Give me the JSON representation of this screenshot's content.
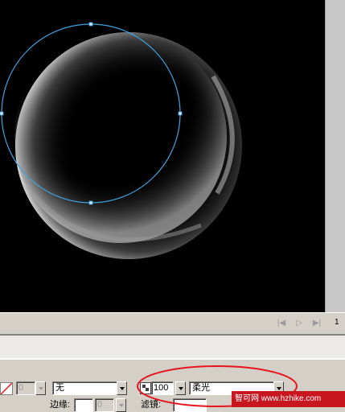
{
  "timeline": {
    "frame_number": "1"
  },
  "properties": {
    "disabled_value": "0",
    "ease_value": "无",
    "alpha_value": "100",
    "blend_mode": "柔光",
    "label_edge": "边缘:",
    "label_filter": "滤镜:",
    "edge_value": "0"
  },
  "watermark": {
    "text": "智可网 www.hzhike.com"
  },
  "colors": {
    "selection_circle": "#3fa3e0",
    "annotation_oval": "#e8141c",
    "stage": "#000000"
  }
}
